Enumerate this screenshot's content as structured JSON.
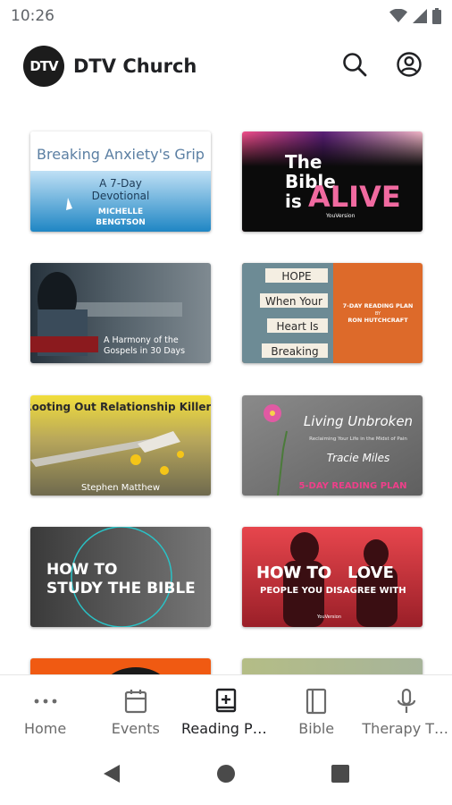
{
  "status_bar": {
    "time": "10:26",
    "icons": [
      "wifi-icon",
      "cell-signal-icon",
      "battery-icon"
    ]
  },
  "header": {
    "logo_text": "DTV",
    "title": "DTV Church",
    "actions": [
      "search-icon",
      "account-icon"
    ]
  },
  "plans": [
    {
      "title": "Breaking Anxiety's Grip",
      "subtitle1": "A 7-Day",
      "subtitle2": "Devotional",
      "author1": "MICHELLE",
      "author2": "BENGTSON"
    },
    {
      "line1": "The",
      "line2": "Bible",
      "line3": "is",
      "highlight": "ALIVE",
      "brand": "YouVersion"
    },
    {
      "title1": "A Harmony of the",
      "title2": "Gospels in 30 Days"
    },
    {
      "words": [
        "HOPE",
        "When Your",
        "Heart Is",
        "Breaking"
      ],
      "plan_label": "7-DAY READING PLAN",
      "by": "BY",
      "author": "RON HUTCHCRAFT"
    },
    {
      "title": "Rooting Out Relationship Killers",
      "author": "Stephen Matthew"
    },
    {
      "title": "Living Unbroken",
      "subtitle": "Reclaiming Your Life in the Midst of Pain",
      "author": "Tracie Miles",
      "plan_label": "5-DAY READING PLAN"
    },
    {
      "line1": "HOW TO",
      "line2": "STUDY THE BIBLE"
    },
    {
      "line1a": "HOW TO",
      "line1b": "LOVE",
      "line2": "PEOPLE YOU DISAGREE WITH",
      "brand": "YouVersion"
    },
    {},
    {}
  ],
  "bottom_nav": {
    "items": [
      {
        "label": "Home",
        "icon": "more-horizontal-icon",
        "active": false
      },
      {
        "label": "Events",
        "icon": "calendar-icon",
        "active": false
      },
      {
        "label": "Reading Pla…",
        "icon": "reading-plan-icon",
        "active": true
      },
      {
        "label": "Bible",
        "icon": "bible-icon",
        "active": false
      },
      {
        "label": "Therapy Th…",
        "icon": "microphone-icon",
        "active": false
      }
    ]
  },
  "system_nav": [
    "back-icon",
    "home-circle-icon",
    "recents-icon"
  ],
  "colors": {
    "accent_dark": "#202124",
    "muted": "#6b6b6b",
    "love_red": "#d8313a",
    "alive_pink": "#f06aa0",
    "hope_orange": "#dd6a2a",
    "living_pink": "#ef3f8a"
  }
}
